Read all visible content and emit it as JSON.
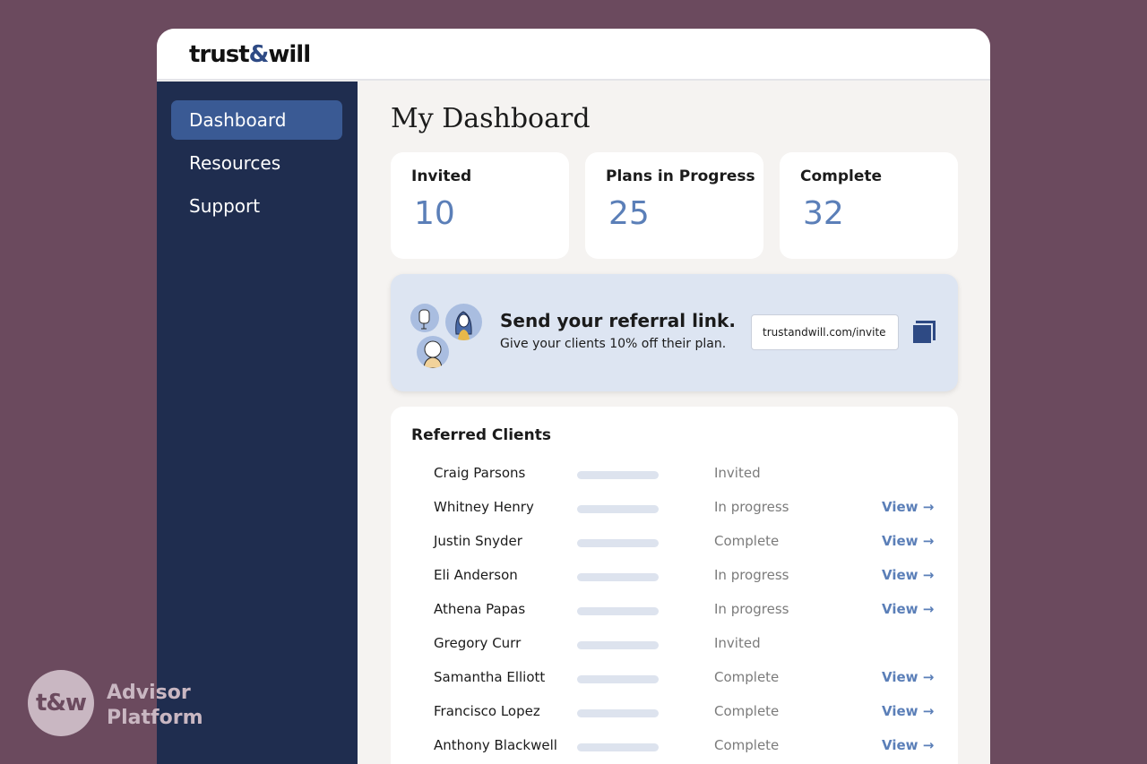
{
  "app": {
    "logo": {
      "left": "trust",
      "amp": "&",
      "right": "will"
    }
  },
  "sidebar": {
    "items": [
      {
        "label": "Dashboard",
        "active": true
      },
      {
        "label": "Resources",
        "active": false
      },
      {
        "label": "Support",
        "active": false
      }
    ]
  },
  "main": {
    "title": "My Dashboard",
    "stats": [
      {
        "label": "Invited",
        "value": "10"
      },
      {
        "label": "Plans in Progress",
        "value": "25"
      },
      {
        "label": "Complete",
        "value": "32"
      }
    ],
    "referral": {
      "title": "Send your referral link.",
      "subtitle": "Give your clients 10% off their plan.",
      "link": "trustandwill.com/invite"
    },
    "clients": {
      "title": "Referred Clients",
      "view_label": "View →",
      "rows": [
        {
          "name": "Craig Parsons",
          "status": "Invited",
          "view": ""
        },
        {
          "name": "Whitney Henry",
          "status": "In progress",
          "view": "View →"
        },
        {
          "name": "Justin Snyder",
          "status": "Complete",
          "view": "View →"
        },
        {
          "name": "Eli Anderson",
          "status": "In progress",
          "view": "View →"
        },
        {
          "name": "Athena Papas",
          "status": "In progress",
          "view": "View →"
        },
        {
          "name": "Gregory Curr",
          "status": "Invited",
          "view": ""
        },
        {
          "name": "Samantha Elliott",
          "status": "Complete",
          "view": "View →"
        },
        {
          "name": "Francisco Lopez",
          "status": "Complete",
          "view": "View →"
        },
        {
          "name": "Anthony Blackwell",
          "status": "Complete",
          "view": "View →"
        }
      ]
    }
  },
  "brand": {
    "mark": "t&w",
    "line1": "Advisor",
    "line2": "Platform"
  },
  "colors": {
    "background": "#6b4a5e",
    "sidebar": "#1f2d4f",
    "accent": "#5b7fb8",
    "active_nav": "#3a5a94"
  }
}
